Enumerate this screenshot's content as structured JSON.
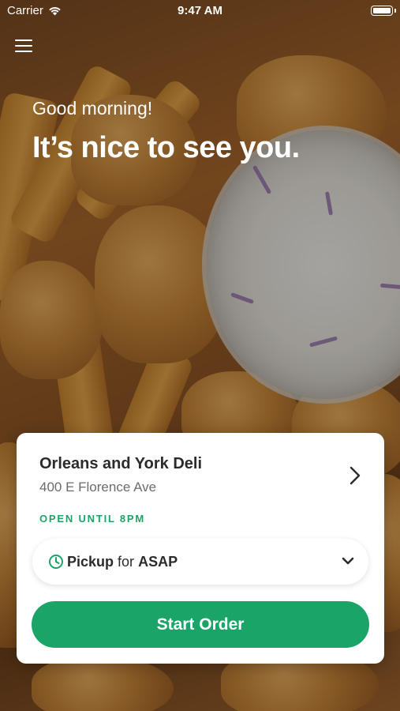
{
  "status_bar": {
    "carrier": "Carrier",
    "time": "9:47 AM",
    "wifi_icon": "wifi-icon",
    "battery_icon": "battery-icon"
  },
  "header": {
    "menu_icon": "hamburger-menu-icon"
  },
  "hero": {
    "greeting": "Good morning!",
    "headline": "It’s nice to see you."
  },
  "store_card": {
    "store_name": "Orleans and York Deli",
    "address": "400 E Florence Ave",
    "open_status": "OPEN UNTIL 8PM",
    "pickup": {
      "method": "Pickup",
      "connector": "for",
      "time": "ASAP",
      "clock_icon": "clock-icon",
      "dropdown_icon": "chevron-down-icon"
    },
    "chevron_icon": "chevron-right-icon",
    "start_button": "Start Order"
  },
  "colors": {
    "accent_green": "#1aa468",
    "card_bg": "#ffffff",
    "text_dark": "#2b2b2b",
    "text_muted": "#6b6b6b"
  }
}
